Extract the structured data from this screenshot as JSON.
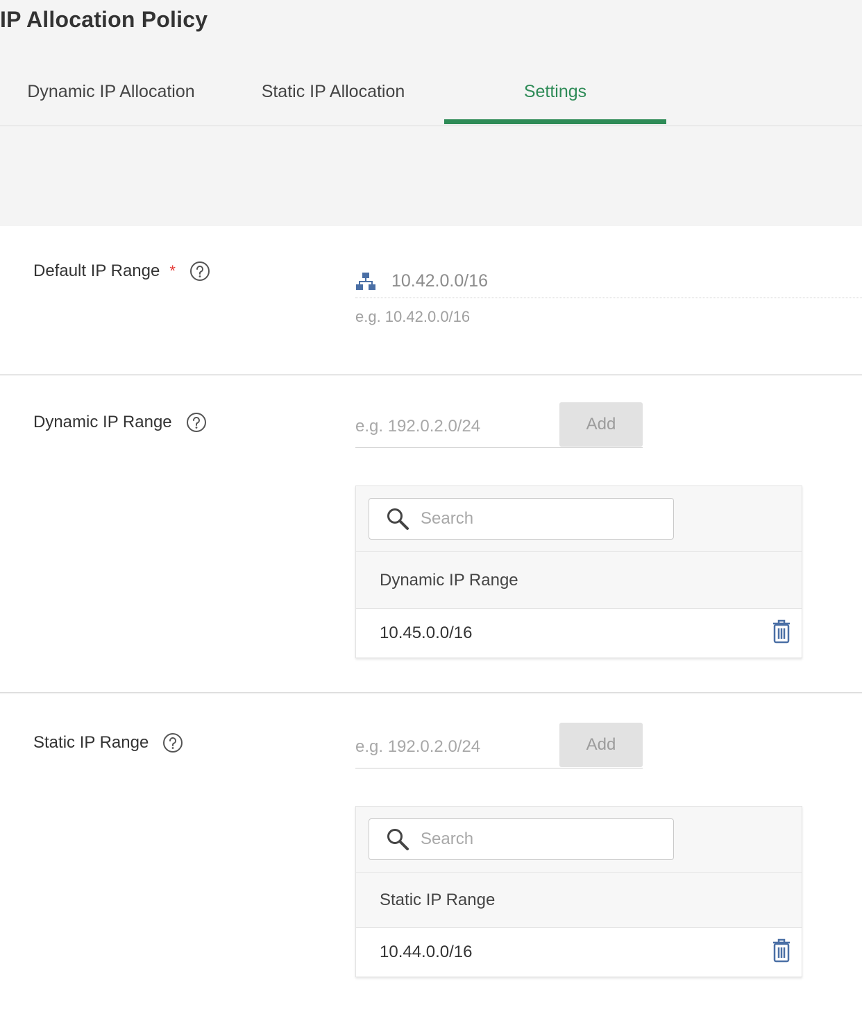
{
  "header": {
    "title": "IP Allocation Policy",
    "tabs": [
      {
        "label": "Dynamic IP Allocation",
        "active": false
      },
      {
        "label": "Static IP Allocation",
        "active": false
      },
      {
        "label": "Settings",
        "active": true
      }
    ]
  },
  "default_range": {
    "label": "Default IP Range",
    "required_mark": "*",
    "value": "10.42.0.0/16",
    "hint": "e.g. 10.42.0.0/16",
    "icon": "network-icon"
  },
  "dynamic_range": {
    "label": "Dynamic IP Range",
    "input_placeholder": "e.g. 192.0.2.0/24",
    "add_label": "Add",
    "search_placeholder": "Search",
    "column_header": "Dynamic IP Range",
    "rows": [
      "10.45.0.0/16"
    ]
  },
  "static_range": {
    "label": "Static IP Range",
    "input_placeholder": "e.g. 192.0.2.0/24",
    "add_label": "Add",
    "search_placeholder": "Search",
    "column_header": "Static IP Range",
    "rows": [
      "10.44.0.0/16"
    ]
  },
  "colors": {
    "accent": "#2e8b57",
    "required": "#e53935",
    "icon_blue": "#4a6fa5"
  }
}
